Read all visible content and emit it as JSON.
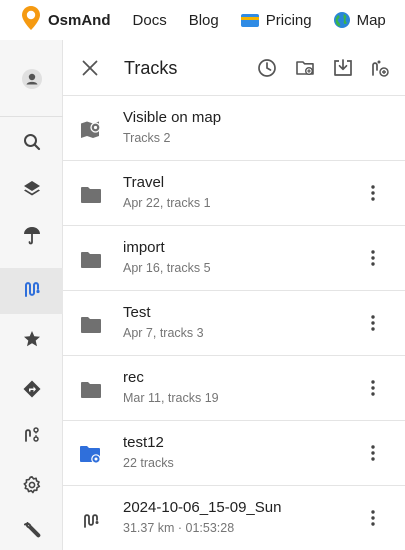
{
  "topnav": {
    "brand": "OsmAnd",
    "links": [
      "Docs",
      "Blog",
      "Pricing",
      "Map"
    ]
  },
  "rail": {
    "items": [
      {
        "name": "account-icon",
        "active": false
      },
      {
        "name": "search-icon",
        "active": false
      },
      {
        "name": "layers-icon",
        "active": false
      },
      {
        "name": "weather-icon",
        "active": false
      },
      {
        "name": "tracks-icon",
        "active": true
      },
      {
        "name": "favorites-icon",
        "active": false
      },
      {
        "name": "navigation-icon",
        "active": false
      },
      {
        "name": "plan-route-icon",
        "active": false
      },
      {
        "name": "settings-icon",
        "active": false
      },
      {
        "name": "tools-icon",
        "active": false
      }
    ]
  },
  "header": {
    "title": "Tracks"
  },
  "tracks": {
    "rows": [
      {
        "name": "Visible on map",
        "sub": "Tracks 2",
        "icon": "visible-map-icon",
        "menu": false
      },
      {
        "name": "Travel",
        "sub": "Apr 22, tracks 1",
        "icon": "folder-icon",
        "menu": true
      },
      {
        "name": "import",
        "sub": "Apr 16, tracks 5",
        "icon": "folder-icon",
        "menu": true
      },
      {
        "name": "Test",
        "sub": "Apr 7, tracks 3",
        "icon": "folder-icon",
        "menu": true
      },
      {
        "name": "rec",
        "sub": "Mar 11, tracks 19",
        "icon": "folder-icon",
        "menu": true
      },
      {
        "name": "test12",
        "sub": "22 tracks",
        "icon": "smart-folder-icon",
        "menu": true
      },
      {
        "name": "2024-10-06_15-09_Sun",
        "sub": "31.37 km · 01:53:28",
        "icon": "track-icon",
        "menu": true
      }
    ]
  },
  "colors": {
    "brand_orange": "#f59a11",
    "folder_grey": "#707070",
    "smart_folder_blue": "#2f6fdb",
    "text": "#212121",
    "muted": "#757575"
  }
}
